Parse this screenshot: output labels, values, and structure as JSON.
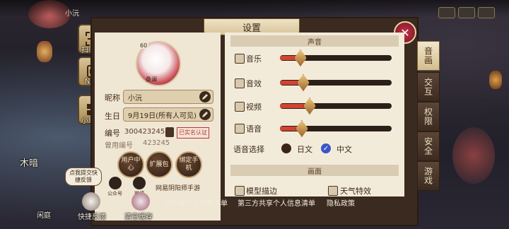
{
  "top": {
    "player_name": "小沅"
  },
  "sidebar": {
    "items": [
      {
        "label": "扫一扫",
        "icon": "scan-icon"
      },
      {
        "label": "NFC",
        "icon": "nfc-icon"
      },
      {
        "label": "小组件",
        "icon": "widget-icon"
      }
    ]
  },
  "dialog": {
    "title": "设置",
    "close_icon": "close-icon"
  },
  "profile": {
    "level": "60",
    "avatar_name": "桑澜",
    "nickname_label": "昵称",
    "nickname": "小沅",
    "birthday_label": "生日",
    "birthday": "9月19日(所有人可见)",
    "id_label": "编号",
    "id": "300423245",
    "verify_badge": "已实名认证",
    "old_id_label": "曾用编号",
    "old_id": "423245",
    "buttons": [
      "用户中心",
      "扩展包",
      "绑定手机"
    ],
    "social": [
      {
        "label": "公众号",
        "icon": "wechat-icon"
      },
      {
        "label": "微博",
        "icon": "weibo-icon"
      }
    ],
    "game_account": "网易阴阳师手游"
  },
  "sound": {
    "section_title": "声音",
    "rows": [
      {
        "label": "音乐",
        "level": 0.18
      },
      {
        "label": "音效",
        "level": 0.2
      },
      {
        "label": "视频",
        "level": 0.26
      },
      {
        "label": "语音",
        "level": 0.19
      }
    ],
    "voice_label": "语音选择",
    "voice_options": [
      {
        "label": "日文",
        "selected": false
      },
      {
        "label": "中文",
        "selected": true
      }
    ]
  },
  "graphics": {
    "section_title": "画面",
    "options": [
      {
        "label": "模型描边"
      },
      {
        "label": "天气特效"
      }
    ]
  },
  "tabs": [
    {
      "label": "音画",
      "active": true
    },
    {
      "label": "交互",
      "active": false
    },
    {
      "label": "权限",
      "active": false
    },
    {
      "label": "安全",
      "active": false
    },
    {
      "label": "游戏",
      "active": false
    }
  ],
  "footer": {
    "links": [
      "已收集个人信息清单",
      "第三方共享个人信息清单",
      "隐私政策"
    ]
  },
  "bottom": {
    "feedback_bubble": "点我提交快捷反馈",
    "feedback_label": "快捷反馈",
    "clear_cache_label": "清空缓存",
    "left_corner_label": "木暗",
    "courtyard_label": "闲庭"
  },
  "colors": {
    "accent_red": "#d4432f",
    "panel_bg": "#f3ebda",
    "frame": "#3b2a1f"
  }
}
